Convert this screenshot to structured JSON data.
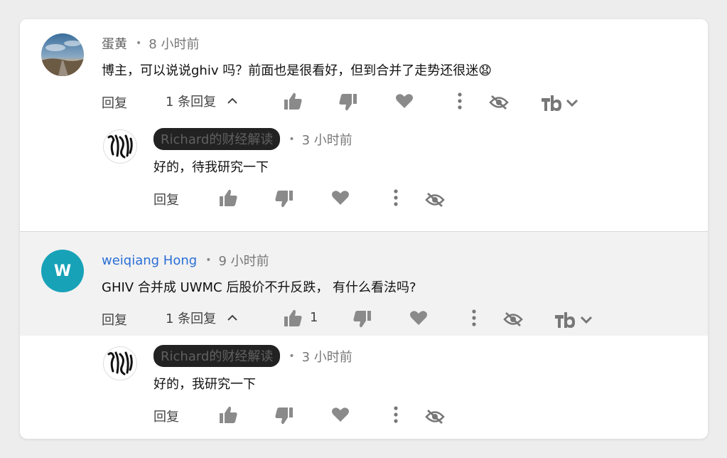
{
  "thread1": {
    "author": "蛋黄",
    "time": "8 小时前",
    "comment": "博主，可以说说ghiv 吗？前面也是很看好，但到合并了走势还很迷",
    "emoji": "😧",
    "reply_label": "回复",
    "replies_toggle": "1 条回复",
    "reply": {
      "author": "Richard的财经解读",
      "time": "3 小时前",
      "text": "好的，待我研究一下",
      "reply_label": "回复"
    }
  },
  "thread2": {
    "author": "weiqiang Hong",
    "avatar_letter": "W",
    "time": "9 小时前",
    "comment": "GHIV 合并成 UWMC 后股价不升反跌， 有什么看法吗?",
    "reply_label": "回复",
    "replies_toggle": "1 条回复",
    "like_count": "1",
    "reply": {
      "author": "Richard的财经解读",
      "time": "3 小时前",
      "text": "好的，我研究一下",
      "reply_label": "回复"
    }
  },
  "colors": {
    "link": "#2a6fd6",
    "chip_bg": "#222222",
    "avatar_teal": "#17a2b8",
    "icon": "#8a8a8a",
    "hover_row": "#f2f2f2"
  },
  "icons": [
    "thumb-up-icon",
    "thumb-down-icon",
    "heart-icon",
    "more-vert-icon",
    "hide-eye-icon",
    "tb-logo-icon",
    "chevron-down-icon",
    "chevron-up-icon"
  ]
}
